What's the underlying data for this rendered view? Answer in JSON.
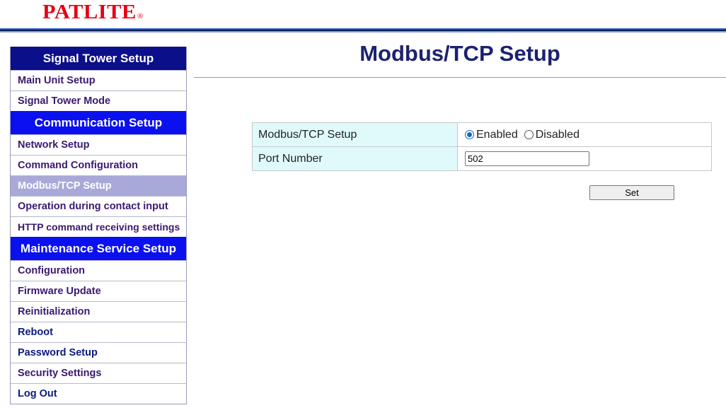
{
  "brand": {
    "logo_text": "PATLITE",
    "logo_mark": "®",
    "color": "#e60012"
  },
  "sidebar": {
    "sections": [
      {
        "header": "Signal Tower Setup",
        "items": [
          "Main Unit Setup",
          "Signal Tower Mode"
        ]
      },
      {
        "header": "Communication Setup",
        "items": [
          "Network Setup",
          "Command Configuration",
          "Modbus/TCP Setup",
          "Operation during contact input",
          "HTTP command receiving settings"
        ]
      },
      {
        "header": "Maintenance Service Setup",
        "items": [
          "Configuration",
          "Firmware Update",
          "Reinitialization",
          "Reboot",
          "Password Setup",
          "Security Settings",
          "Log Out"
        ]
      }
    ],
    "active_item": "Modbus/TCP Setup"
  },
  "main": {
    "title": "Modbus/TCP Setup",
    "rows": {
      "modbus": {
        "label": "Modbus/TCP Setup",
        "enabled_label": "Enabled",
        "disabled_label": "Disabled",
        "selected": "Enabled"
      },
      "port": {
        "label": "Port Number",
        "value": "502"
      }
    },
    "set_label": "Set"
  },
  "colors": {
    "header_dark": "#0b0f8a",
    "header_bright": "#0a10f0",
    "active_item_bg": "#a9a9d9",
    "label_cell_bg": "#e0fafc",
    "title_color": "#1c2270"
  }
}
